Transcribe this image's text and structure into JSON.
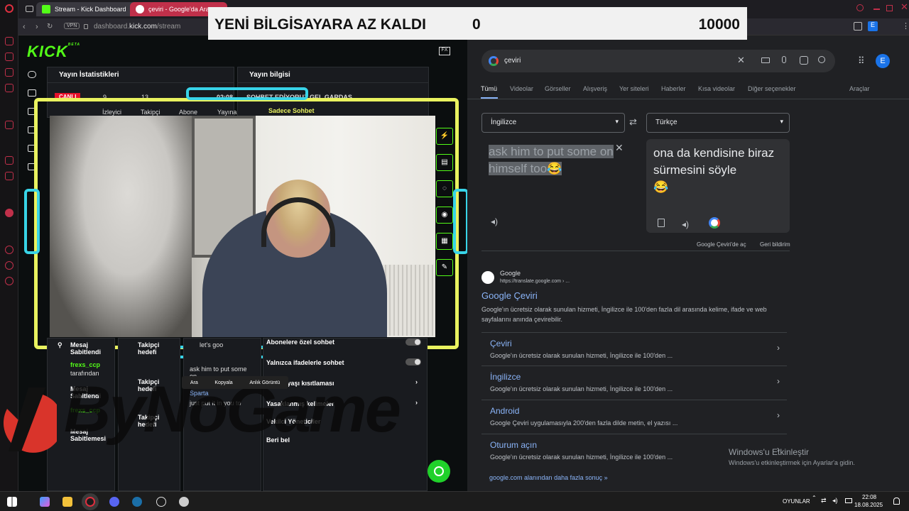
{
  "browser": {
    "tabs": [
      {
        "label": "Stream - Kick Dashboard",
        "favicon": "kick-icon"
      },
      {
        "label": "çeviri - Google'da Ara",
        "favicon": "google-icon"
      }
    ],
    "vpn_label": "VPN",
    "url_prefix": "dashboard.",
    "url_domain": "kick.com",
    "url_path": "/stream"
  },
  "banner": {
    "text": "YENİ BİLGİSAYARA AZ KALDI",
    "current": "0",
    "goal": "10000"
  },
  "kick": {
    "logo": "KICK",
    "logo_beta": "BETA",
    "stats_panel_title": "Yayın İstatistikleri",
    "info_panel_title": "Yayın bilgisi",
    "stats": {
      "live": "CANLI",
      "viewers_value": "9",
      "viewers_label": "İzleyici",
      "followers_value": "13",
      "followers_label": "Takipçi",
      "subs_label": "Abone",
      "time_value": "02:08",
      "time_label": "Yayına"
    },
    "stream_title": "SOHBET EDİYORUZ GEL GARDAŞ",
    "chat_mode": "Sadece Sohbet",
    "pinned_label": "Mesaj Sabitlendi",
    "pinned_by_user": "frexs_ccp",
    "pinned_by_suffix": "tarafından",
    "pinned_label2": "Mesaj Sabitlendi",
    "pinned_user2": "frexs_ccp",
    "pinned_label3": "Mesaj Sabitlemesi",
    "goal1": "Takipçi hedefi",
    "goal2": "Takipçi hedefi",
    "goal3": "Takipçi hedefi",
    "chat_lines": [
      "let's goo",
      "ask him to put some on",
      "just put it in you to",
      "Sparta"
    ],
    "settings": [
      {
        "label": "Abonelere özel sohbet",
        "control": "toggle"
      },
      {
        "label": "Yalnızca ifadelerle sohbet",
        "control": "toggle"
      },
      {
        "label": "Hesap yaşı kısıtlaması",
        "control": "arrow"
      },
      {
        "label": "Yasaklanmış kelimeler",
        "control": "arrow"
      },
      {
        "label": "Vekilci Yöneticiler",
        "control": "arrow"
      },
      {
        "label": "Beri bel",
        "control": "arrow"
      }
    ],
    "context_menu": [
      "Ara",
      "Kopyala",
      "Anlık Görüntü"
    ],
    "watermark": "ByNoGame"
  },
  "google": {
    "search_query": "çeviri",
    "tabs": [
      "Tümü",
      "Videolar",
      "Görseller",
      "Alışveriş",
      "Yer siteleri",
      "Haberler",
      "Kısa videolar",
      "Diğer seçenekler",
      "Araçlar"
    ],
    "source_lang": "İngilizce",
    "target_lang": "Türkçe",
    "source_text": "ask him to put some on himself too",
    "source_emoji": "😂",
    "target_text": "ona da kendisine biraz sürmesini söyle",
    "target_emoji": "😂",
    "open_in_translate": "Google Çeviri'de aç",
    "feedback": "Geri bildirim",
    "result_site": "Google",
    "result_url": "https://translate.google.com › ...",
    "result_title": "Google Çeviri",
    "result_desc": "Google'ın ücretsiz olarak sunulan hizmeti, İngilizce ile 100'den fazla dil arasında kelime, ifade ve web sayfalarını anında çevirebilir.",
    "sublinks": [
      {
        "title": "Çeviri",
        "desc": "Google'ın ücretsiz olarak sunulan hizmeti, İngilizce ile 100'den ..."
      },
      {
        "title": "İngilizce",
        "desc": "Google'ın ücretsiz olarak sunulan hizmeti, İngilizce ile 100'den ..."
      },
      {
        "title": "Android",
        "desc": "Google Çeviri uygulamasıyla 200'den fazla dilde metin, el yazısı ..."
      },
      {
        "title": "Oturum açın",
        "desc": "Google'ın ücretsiz olarak sunulan hizmeti, İngilizce ile 100'den ..."
      }
    ],
    "more_results": "google.com alanından daha fazla sonuç »",
    "avatar_letter": "E"
  },
  "windows": {
    "activate_title": "Windows'u Etkinleştir",
    "activate_desc": "Windows'u etkinleştirmek için Ayarlar'a gidin."
  },
  "taskbar": {
    "tray_label": "OYUNLAR",
    "time": "22:08",
    "date": "18.08.2025"
  },
  "colors": {
    "kick_green": "#53fc18",
    "frame_yellow": "#e9f25f",
    "frame_cyan": "#38d4e8",
    "google_link": "#8ab4f8"
  }
}
